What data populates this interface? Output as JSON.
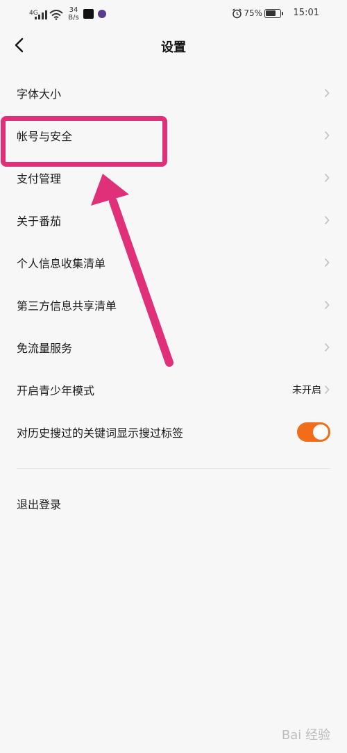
{
  "status_bar": {
    "network": "4G",
    "speed_value": "34",
    "speed_unit": "B/s",
    "battery_percent": "75%",
    "battery_level": 0.75,
    "time": "15:01"
  },
  "header": {
    "title": "设置",
    "back_icon": "chevron-left-icon"
  },
  "settings": {
    "items": [
      {
        "label": "字体大小"
      },
      {
        "label": "帐号与安全"
      },
      {
        "label": "支付管理"
      },
      {
        "label": "关于番茄"
      },
      {
        "label": "个人信息收集清单"
      },
      {
        "label": "第三方信息共享清单"
      },
      {
        "label": "免流量服务"
      },
      {
        "label": "开启青少年模式",
        "value": "未开启"
      },
      {
        "label": "对历史搜过的关键词显示搜过标签",
        "toggle_on": true
      }
    ],
    "logout_label": "退出登录"
  },
  "colors": {
    "accent": "#f26c1a",
    "annotation": "#e0307a",
    "background": "#f7f7f7"
  },
  "watermark": "Bai 经验"
}
